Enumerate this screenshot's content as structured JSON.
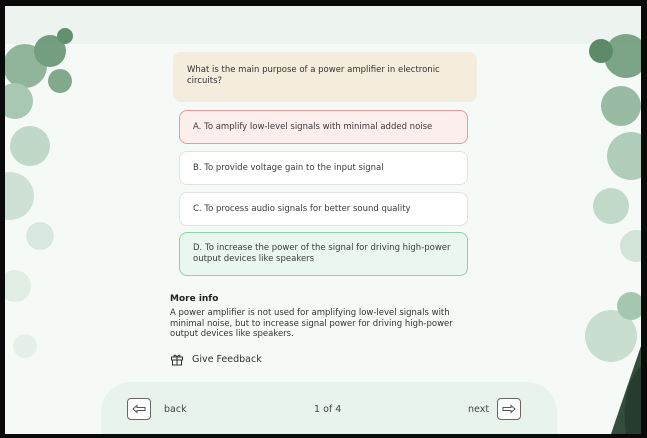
{
  "question": "What is the main purpose of a power amplifier in electronic circuits?",
  "options": [
    {
      "label": "A. To amplify low-level signals with minimal added noise",
      "state": "wrong"
    },
    {
      "label": "B. To provide voltage gain to the input signal",
      "state": "neutral"
    },
    {
      "label": "C. To process audio signals for better sound quality",
      "state": "neutral"
    },
    {
      "label": "D. To increase the power of the signal for driving high-power output devices like speakers",
      "state": "correct"
    }
  ],
  "more_info": {
    "title": "More info",
    "text": "A power amplifier is not used for amplifying low-level signals with minimal noise, but to increase signal power for driving high-power output devices like speakers."
  },
  "feedback": {
    "label": "Give Feedback",
    "icon": "gift-icon"
  },
  "navigation": {
    "back_label": "back",
    "next_label": "next",
    "page_indicator": "1 of 4",
    "back_icon": "arrow-left-icon",
    "next_icon": "arrow-right-icon"
  },
  "colors": {
    "wrong_bg": "#fdeeee",
    "wrong_border": "#e89a9a",
    "correct_bg": "#eaf7ee",
    "correct_border": "#8fd2a8",
    "question_bg": "#f4ecdd"
  }
}
